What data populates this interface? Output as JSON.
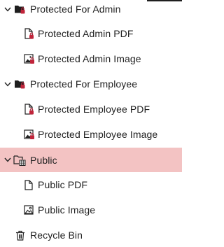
{
  "tree": {
    "items": [
      {
        "label": "Protected For Admin",
        "icon": "locked-folder-icon",
        "expanded": true
      },
      {
        "label": "Protected Admin PDF",
        "icon": "locked-document-icon"
      },
      {
        "label": "Protected Admin Image",
        "icon": "locked-image-icon"
      },
      {
        "label": "Protected For Employee",
        "icon": "locked-folder-icon",
        "expanded": true
      },
      {
        "label": "Protected Employee PDF",
        "icon": "locked-document-icon"
      },
      {
        "label": "Protected Employee Image",
        "icon": "locked-image-icon"
      },
      {
        "label": "Public",
        "icon": "public-folder-icon",
        "expanded": true,
        "selected": true
      },
      {
        "label": "Public PDF",
        "icon": "document-icon"
      },
      {
        "label": "Public Image",
        "icon": "image-icon"
      },
      {
        "label": "Recycle Bin",
        "icon": "trash-icon"
      }
    ]
  },
  "colors": {
    "selected_row": "#f3c3c3",
    "lock_badge": "#c0243a",
    "text": "#222222"
  }
}
